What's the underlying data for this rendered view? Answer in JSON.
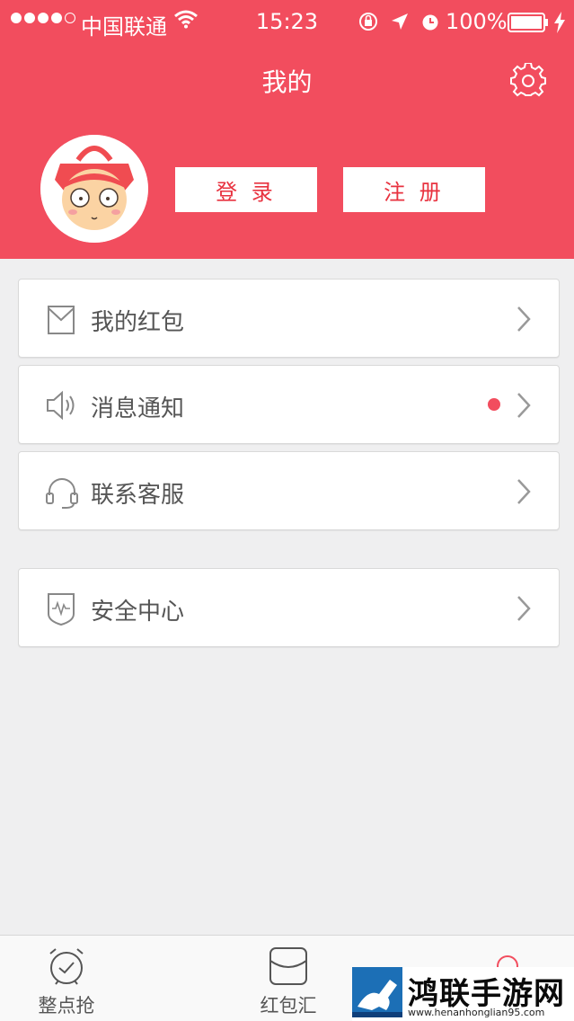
{
  "status_bar": {
    "carrier": "中国联通",
    "time": "15:23",
    "battery": "100%",
    "signal_bars_filled": 4,
    "signal_bars_total": 5
  },
  "header": {
    "title": "我的",
    "login_label": "登 录",
    "register_label": "注 册",
    "settings_icon": "gear-icon",
    "bg_color": "#f24d5e"
  },
  "menu": {
    "items": [
      {
        "label": "我的红包",
        "icon": "envelope-icon",
        "badge": false
      },
      {
        "label": "消息通知",
        "icon": "speaker-icon",
        "badge": true
      },
      {
        "label": "联系客服",
        "icon": "headset-icon",
        "badge": false
      },
      {
        "label": "安全中心",
        "icon": "shield-icon",
        "badge": false
      }
    ]
  },
  "tabs": [
    {
      "label": "整点抢",
      "icon": "alarm-clock-icon"
    },
    {
      "label": "红包汇",
      "icon": "envelope-icon"
    },
    {
      "label": "",
      "icon": "profile-icon"
    }
  ],
  "watermark": {
    "title": "鸿联手游网",
    "url": "www.henanhonglian95.com"
  }
}
